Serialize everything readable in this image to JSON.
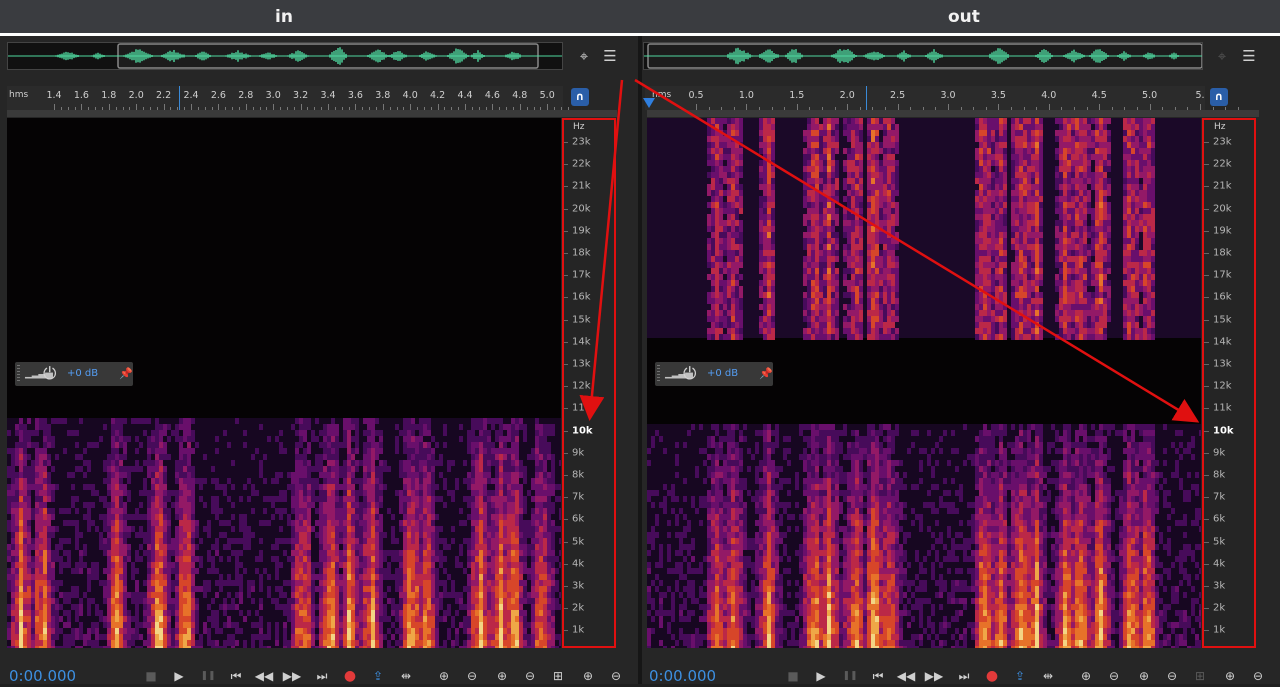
{
  "header": {
    "left_label": "in",
    "right_label": "out"
  },
  "colors": {
    "accent": "#3d8fe0",
    "annotation": "#e01010",
    "waveform": "#4fd9a0"
  },
  "panels": [
    {
      "id": "in",
      "ruler": {
        "unit": "hms",
        "ticks": [
          "1.4",
          "1.6",
          "1.8",
          "2.0",
          "2.2",
          "2.4",
          "2.6",
          "2.8",
          "3.0",
          "3.2",
          "3.4",
          "3.6",
          "3.8",
          "4.0",
          "4.2",
          "4.4",
          "4.6",
          "4.8",
          "5.0"
        ]
      },
      "freq": {
        "unit": "Hz",
        "labels": [
          "23k",
          "22k",
          "21k",
          "20k",
          "19k",
          "18k",
          "17k",
          "16k",
          "15k",
          "14k",
          "13k",
          "12k",
          "11k",
          "10k",
          "9k",
          "8k",
          "7k",
          "6k",
          "5k",
          "4k",
          "3k",
          "2k",
          "1k"
        ]
      },
      "hud": {
        "gain": "+0 dB"
      },
      "timecode": "0:00.000"
    },
    {
      "id": "out",
      "ruler": {
        "unit": "hms",
        "ticks": [
          "0.5",
          "1.0",
          "1.5",
          "2.0",
          "2.5",
          "3.0",
          "3.5",
          "4.0",
          "4.5",
          "5.0",
          "5."
        ]
      },
      "freq": {
        "unit": "Hz",
        "labels": [
          "23k",
          "22k",
          "21k",
          "20k",
          "19k",
          "18k",
          "17k",
          "16k",
          "15k",
          "14k",
          "13k",
          "12k",
          "11k",
          "10k",
          "9k",
          "8k",
          "7k",
          "6k",
          "5k",
          "4k",
          "3k",
          "2k",
          "1k"
        ]
      },
      "hud": {
        "gain": "+0 dB"
      },
      "timecode": "0:00.000"
    }
  ],
  "icons": {
    "zoom_overview": "zoom-to-selection-icon",
    "channel_menu": "panel-menu-icon",
    "snap": "magnet-snap-icon",
    "hud_knob": "power-knob-icon",
    "hud_pin": "pin-icon",
    "transport": [
      "stop-icon",
      "play-icon",
      "pause-icon",
      "skip-to-start-icon",
      "rewind-icon",
      "fast-forward-icon",
      "skip-to-end-icon",
      "record-icon",
      "loop-icon",
      "skip-selection-icon",
      "zoom-in-amplitude-icon",
      "zoom-out-amplitude-icon",
      "zoom-in-time-icon",
      "zoom-out-time-icon",
      "zoom-selection-icon",
      "zoom-in-point-icon",
      "zoom-out-point-icon",
      "zoom-full-icon"
    ]
  },
  "spectrogram": {
    "in": {
      "burst_positions_s": [
        1.2,
        1.35,
        1.9,
        2.2,
        2.4,
        3.25,
        3.45,
        3.6,
        3.75,
        4.05,
        4.15,
        4.55,
        4.7,
        4.8,
        5.0
      ],
      "cutoff_hz": 11000
    },
    "out": {
      "burst_positions_s": [
        0.75,
        0.9,
        1.25,
        1.7,
        1.85,
        2.1,
        2.3,
        2.45,
        3.4,
        3.55,
        3.75,
        3.9,
        4.2,
        4.35,
        4.55,
        4.85,
        5.0
      ],
      "filled_band_hz": [
        12000,
        23500
      ]
    }
  }
}
